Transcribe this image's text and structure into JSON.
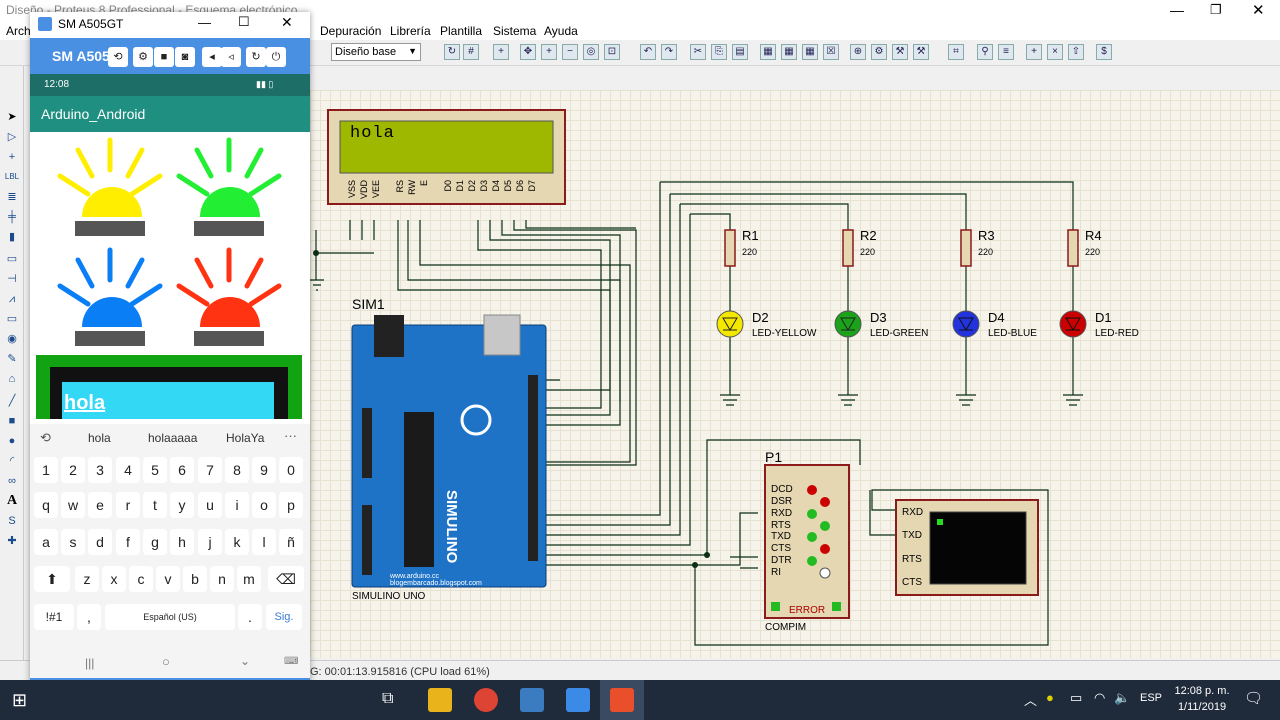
{
  "proteus": {
    "title": "Diseño - Proteus 8 Professional - Esquema electrónico",
    "menus": [
      "Arch",
      "Depuración",
      "Librería",
      "Plantilla",
      "Sistema",
      "Ayuda"
    ],
    "layer_select": "Diseño base",
    "status": "G: 00:01:13.915816 (CPU load 61%)"
  },
  "phone": {
    "window_title": "SM A505GT",
    "device_label": "SM A505",
    "time": "12:08",
    "app_title": "Arduino_Android",
    "display_text": "hola",
    "suggestions": [
      "hola",
      "holaaaaa",
      "HolaYa"
    ],
    "keys_row1": [
      "1",
      "2",
      "3",
      "4",
      "5",
      "6",
      "7",
      "8",
      "9",
      "0"
    ],
    "keys_row2": [
      "q",
      "w",
      "e",
      "r",
      "t",
      "y",
      "u",
      "i",
      "o",
      "p"
    ],
    "keys_row3": [
      "a",
      "s",
      "d",
      "f",
      "g",
      "h",
      "j",
      "k",
      "l",
      "ñ"
    ],
    "keys_row4": [
      "z",
      "x",
      "c",
      "v",
      "b",
      "n",
      "m"
    ],
    "sym_key": "!#1",
    "comma_key": ",",
    "space_key": "Español (US)",
    "period_key": ".",
    "next_key": "Sig."
  },
  "circuit": {
    "lcd_text": "hola",
    "lcd_pins": [
      "VSS",
      "VDD",
      "VEE",
      "RS",
      "RW",
      "E",
      "D0",
      "D1",
      "D2",
      "D3",
      "D4",
      "D5",
      "D6",
      "D7"
    ],
    "arduino_ref": "SIM1",
    "arduino_name": "SIMULINO UNO",
    "arduino_brand": "SIMULINO",
    "arduino_url": "www.arduino.cc",
    "arduino_blog": "blogembarcado.blogspot.com",
    "resistors": [
      {
        "ref": "R1",
        "val": "220"
      },
      {
        "ref": "R2",
        "val": "220"
      },
      {
        "ref": "R3",
        "val": "220"
      },
      {
        "ref": "R4",
        "val": "220"
      }
    ],
    "leds": [
      {
        "ref": "D2",
        "name": "LED-YELLOW",
        "color": "#f5e800"
      },
      {
        "ref": "D3",
        "name": "LED-GREEN",
        "color": "#1aa31a"
      },
      {
        "ref": "D4",
        "name": "LED-BLUE",
        "color": "#2233dd"
      },
      {
        "ref": "D1",
        "name": "LED-RED",
        "color": "#cc0000"
      }
    ],
    "compim_ref": "P1",
    "compim_name": "COMPIM",
    "compim_error": "ERROR",
    "compim_pins": [
      "DCD",
      "DSR",
      "RXD",
      "RTS",
      "TXD",
      "CTS",
      "DTR",
      "RI"
    ],
    "terminal_pins": [
      "RXD",
      "TXD",
      "RTS",
      "CTS"
    ]
  },
  "taskbar": {
    "lang": "ESP",
    "time": "12:08 p. m.",
    "date": "1/11/2019"
  }
}
